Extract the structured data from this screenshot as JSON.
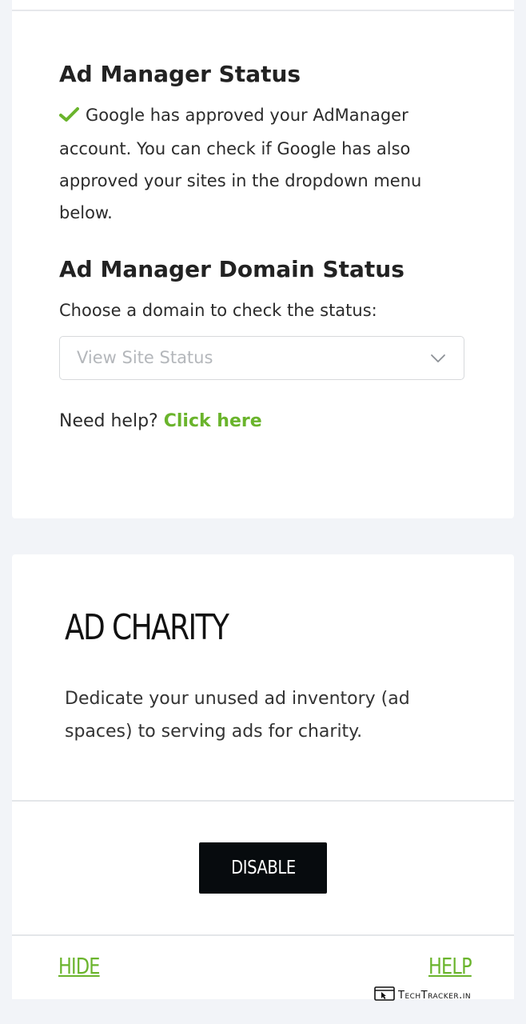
{
  "admanager": {
    "status_heading": "Ad Manager Status",
    "status_text": "Google has approved your AdManager account. You can check if Google has also approved your sites in the dropdown menu below.",
    "domain_heading": "Ad Manager Domain Status",
    "domain_prompt": "Choose a domain to check the status:",
    "select_value": "View Site Status",
    "help_prefix": "Need help?",
    "help_link": "Click here",
    "accent_color": "#6ab42c"
  },
  "charity": {
    "title": "AD CHARITY",
    "description": "Dedicate your unused ad inventory (ad spaces) to serving ads for charity.",
    "disable_label": "DISABLE",
    "hide_label": "HIDE",
    "help_label": "HELP"
  },
  "watermark": {
    "text": "TechTracker.in"
  }
}
